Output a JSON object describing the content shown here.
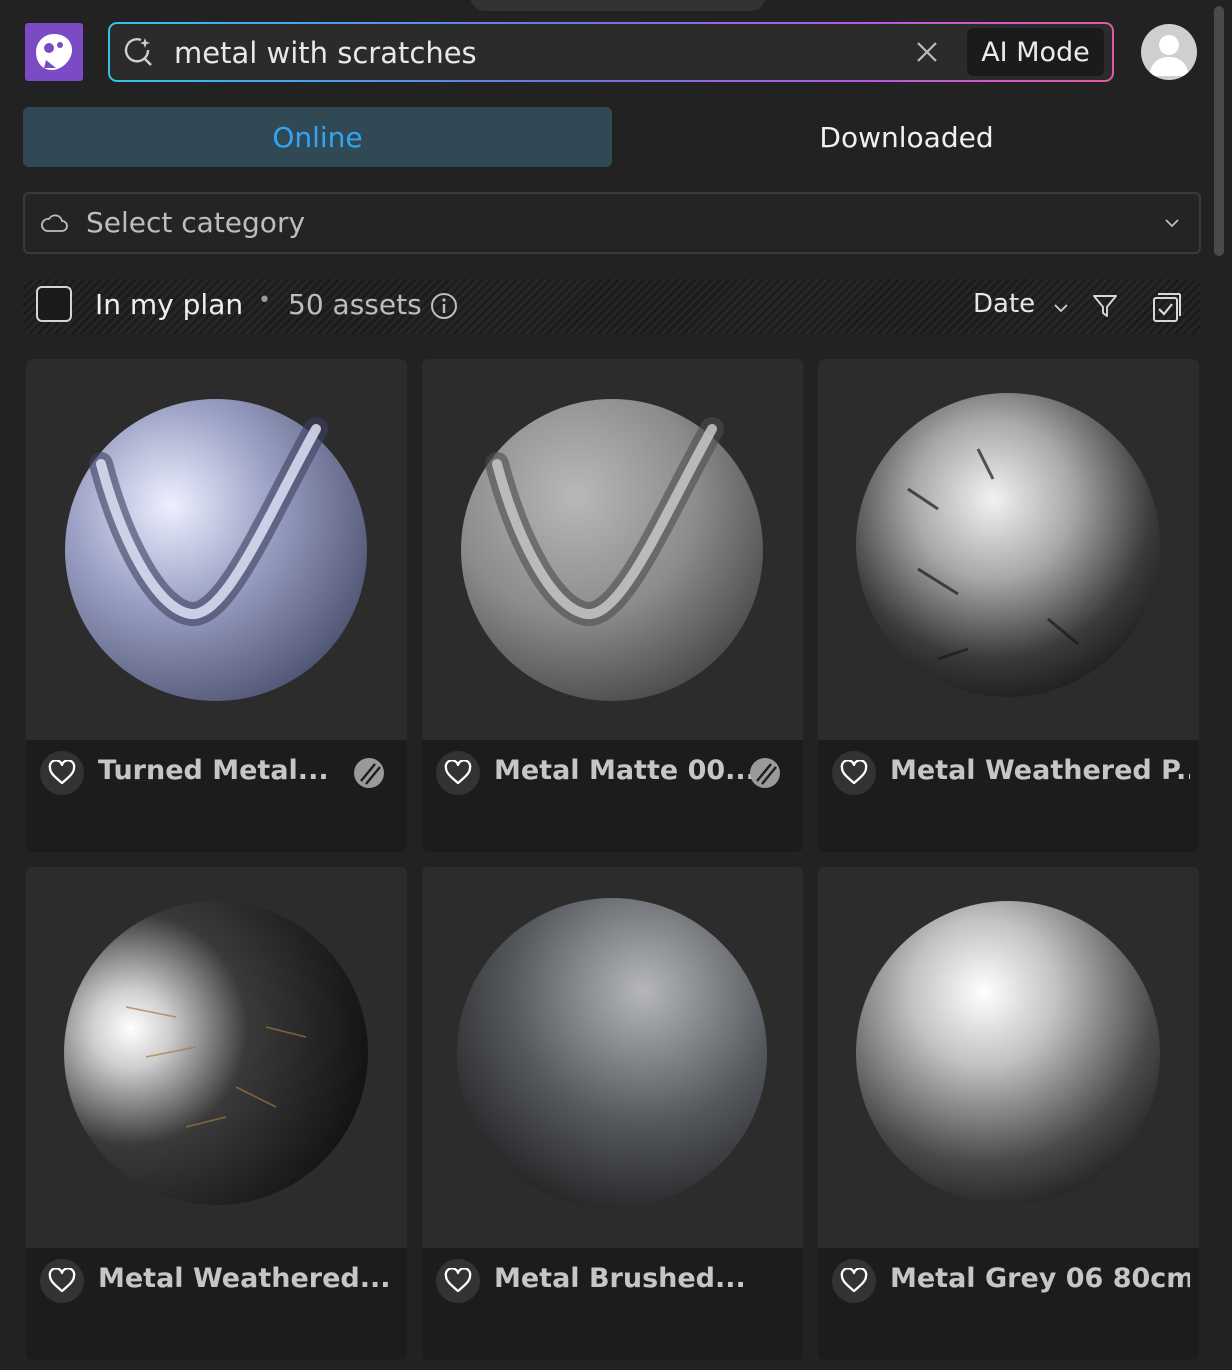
{
  "search": {
    "query": "metal with scratches",
    "ai_mode_label": "AI Mode"
  },
  "tabs": {
    "online": "Online",
    "downloaded": "Downloaded"
  },
  "category": {
    "placeholder": "Select category"
  },
  "filter_bar": {
    "plan_label": "In my plan",
    "separator": "•",
    "asset_count": "50 assets",
    "sort_label": "Date"
  },
  "assets": [
    {
      "title": "Turned Metal...",
      "badge": true
    },
    {
      "title": "Metal Matte 00...",
      "badge": true
    },
    {
      "title": "Metal Weathered P...",
      "badge": false
    },
    {
      "title": "Metal Weathered...",
      "badge": false
    },
    {
      "title": "Metal Brushed...",
      "badge": false
    },
    {
      "title": "Metal Grey 06 80cm",
      "badge": false
    }
  ],
  "colors": {
    "accent": "#2fa6f5",
    "brand": "#7a4bc4",
    "active_tab_bg": "#314955"
  },
  "icons": [
    "app-logo-icon",
    "search-icon",
    "clear-icon",
    "user-avatar-icon",
    "cloud-icon",
    "chevron-down-icon",
    "info-icon",
    "filter-icon",
    "select-all-icon",
    "heart-icon",
    "material-badge-icon"
  ]
}
